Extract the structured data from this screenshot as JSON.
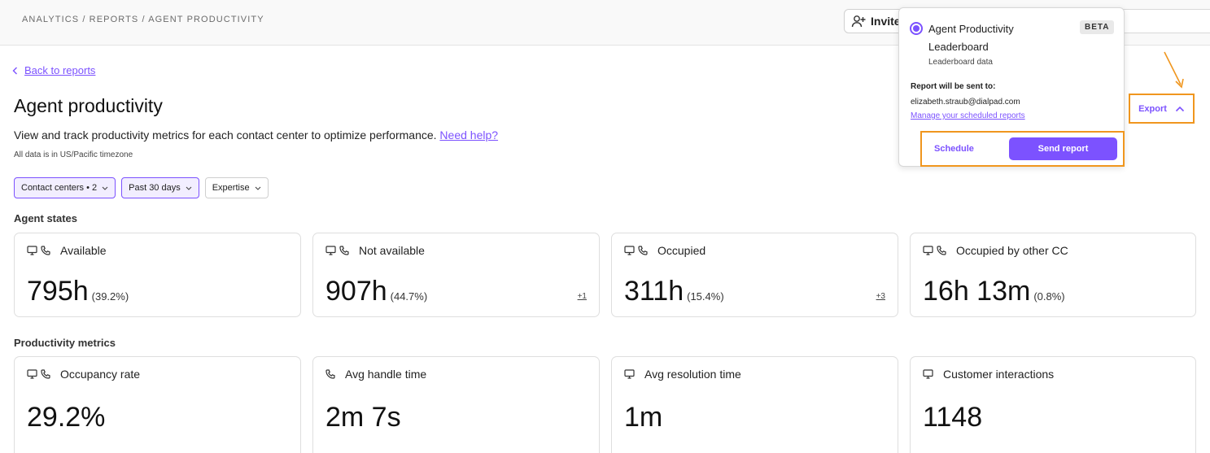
{
  "breadcrumb": "ANALYTICS / REPORTS / AGENT PRODUCTIVITY",
  "topbar": {
    "invite_label": "Invite"
  },
  "back_link": "Back to reports",
  "page": {
    "title": "Agent productivity",
    "description": "View and track productivity metrics for each contact center to optimize performance.",
    "help_link": "Need help?",
    "timezone_note": "All data is in US/Pacific timezone"
  },
  "filters": [
    {
      "label": "Contact centers • 2",
      "active": true
    },
    {
      "label": "Past 30 days",
      "active": true
    },
    {
      "label": "Expertise",
      "active": false
    }
  ],
  "sections": {
    "agent_states": "Agent states",
    "productivity_metrics": "Productivity metrics"
  },
  "agent_state_cards": [
    {
      "label": "Available",
      "value": "795h",
      "percent": "(39.2%)",
      "more": "",
      "icons": [
        "monitor-icon",
        "phone-icon"
      ]
    },
    {
      "label": "Not available",
      "value": "907h",
      "percent": "(44.7%)",
      "more": "+1",
      "icons": [
        "monitor-icon",
        "phone-icon"
      ]
    },
    {
      "label": "Occupied",
      "value": "311h",
      "percent": "(15.4%)",
      "more": "+3",
      "icons": [
        "monitor-icon",
        "phone-icon"
      ]
    },
    {
      "label": "Occupied by other CC",
      "value": "16h 13m",
      "percent": "(0.8%)",
      "more": "",
      "icons": [
        "monitor-icon",
        "phone-icon"
      ]
    }
  ],
  "productivity_cards": [
    {
      "label": "Occupancy rate",
      "value": "29.2%",
      "icons": [
        "monitor-icon",
        "phone-icon"
      ]
    },
    {
      "label": "Avg handle time",
      "value": "2m 7s",
      "icons": [
        "phone-icon"
      ]
    },
    {
      "label": "Avg resolution time",
      "value": "1m",
      "icons": [
        "monitor-icon"
      ]
    },
    {
      "label": "Customer interactions",
      "value": "1148",
      "icons": [
        "monitor-icon"
      ]
    }
  ],
  "export": {
    "label": "Export"
  },
  "popover": {
    "report_title": "Agent Productivity Leaderboard",
    "badge": "BETA",
    "report_subtitle": "Leaderboard data",
    "sent_to_label": "Report will be sent to:",
    "email": "elizabeth.straub@dialpad.com",
    "manage_link": "Manage your scheduled reports",
    "schedule_label": "Schedule",
    "send_label": "Send report"
  },
  "colors": {
    "accent": "#7c52ff",
    "highlight": "#f0961e",
    "chip_active_bg": "#f2eeff"
  }
}
